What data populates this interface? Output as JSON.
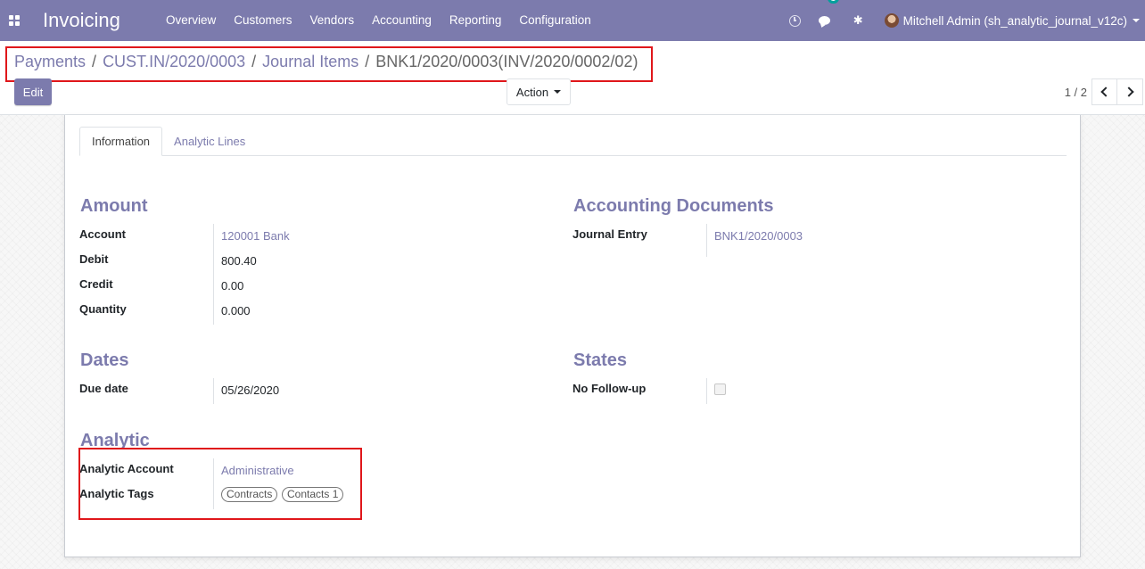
{
  "navbar": {
    "brand": "Invoicing",
    "menu": [
      "Overview",
      "Customers",
      "Vendors",
      "Accounting",
      "Reporting",
      "Configuration"
    ],
    "chat_badge": "1",
    "user_name": "Mitchell Admin (sh_analytic_journal_v12c)",
    "icons": [
      "apps-icon",
      "clock-icon",
      "chat-icon",
      "bug-icon",
      "avatar"
    ],
    "color": "#7c7bad"
  },
  "breadcrumb": {
    "items": [
      "Payments",
      "CUST.IN/2020/0003",
      "Journal Items"
    ],
    "current": "BNK1/2020/0003(INV/2020/0002/02)"
  },
  "controls": {
    "edit_label": "Edit",
    "action_label": "Action",
    "pager": "1 / 2"
  },
  "tabs": [
    "Information",
    "Analytic Lines"
  ],
  "groups": {
    "amount": {
      "title": "Amount",
      "fields": [
        {
          "label": "Account",
          "value": "120001 Bank",
          "link": true
        },
        {
          "label": "Debit",
          "value": "800.40",
          "link": false
        },
        {
          "label": "Credit",
          "value": "0.00",
          "link": false
        },
        {
          "label": "Quantity",
          "value": "0.000",
          "link": false
        }
      ]
    },
    "accounting_documents": {
      "title": "Accounting Documents",
      "fields": [
        {
          "label": "Journal Entry",
          "value": "BNK1/2020/0003",
          "link": true
        }
      ]
    },
    "dates": {
      "title": "Dates",
      "fields": [
        {
          "label": "Due date",
          "value": "05/26/2020",
          "link": false
        }
      ]
    },
    "states": {
      "title": "States",
      "fields": [
        {
          "label": "No Follow-up",
          "checked": false
        }
      ]
    },
    "analytic": {
      "title": "Analytic",
      "account_label": "Analytic Account",
      "account_value": "Administrative",
      "tags_label": "Analytic Tags",
      "tags": [
        "Contracts",
        "Contacts 1"
      ]
    }
  },
  "highlight_color": "#e0171b"
}
